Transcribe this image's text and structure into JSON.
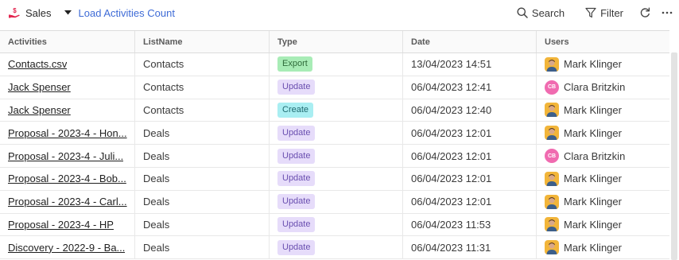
{
  "toolbar": {
    "app_icon": "money-hand-icon",
    "app_label": "Sales",
    "caret_icon": "caret-down-icon",
    "load_link": "Load Activities Count",
    "search_label": "Search",
    "filter_label": "Filter",
    "refresh_icon": "refresh-icon",
    "more_icon": "more-horizontal-icon"
  },
  "columns": [
    "Activities",
    "ListName",
    "Type",
    "Date",
    "Users"
  ],
  "badge_colors": {
    "Export": {
      "bg": "#a8ecb6",
      "fg": "#2f6b3a"
    },
    "Update": {
      "bg": "#e6dcfa",
      "fg": "#6a4fb0"
    },
    "Create": {
      "bg": "#a9eef2",
      "fg": "#1f6a70"
    }
  },
  "rows": [
    {
      "activity": "Contacts.csv",
      "list": "Contacts",
      "type": "Export",
      "date": "13/04/2023 14:51",
      "user": "Mark Klinger",
      "avatar": "photo"
    },
    {
      "activity": "Jack Spenser",
      "list": "Contacts",
      "type": "Update",
      "date": "06/04/2023 12:41",
      "user": "Clara Britzkin",
      "avatar": "CB"
    },
    {
      "activity": "Jack Spenser",
      "list": "Contacts",
      "type": "Create",
      "date": "06/04/2023 12:40",
      "user": "Mark Klinger",
      "avatar": "photo"
    },
    {
      "activity": "Proposal - 2023-4 - Hon...",
      "list": "Deals",
      "type": "Update",
      "date": "06/04/2023 12:01",
      "user": "Mark Klinger",
      "avatar": "photo"
    },
    {
      "activity": "Proposal - 2023-4 - Juli...",
      "list": "Deals",
      "type": "Update",
      "date": "06/04/2023 12:01",
      "user": "Clara Britzkin",
      "avatar": "CB"
    },
    {
      "activity": "Proposal - 2023-4 - Bob...",
      "list": "Deals",
      "type": "Update",
      "date": "06/04/2023 12:01",
      "user": "Mark Klinger",
      "avatar": "photo"
    },
    {
      "activity": "Proposal - 2023-4 - Carl...",
      "list": "Deals",
      "type": "Update",
      "date": "06/04/2023 12:01",
      "user": "Mark Klinger",
      "avatar": "photo"
    },
    {
      "activity": "Proposal - 2023-4 - HP",
      "list": "Deals",
      "type": "Update",
      "date": "06/04/2023 11:53",
      "user": "Mark Klinger",
      "avatar": "photo"
    },
    {
      "activity": "Discovery - 2022-9 - Ba...",
      "list": "Deals",
      "type": "Update",
      "date": "06/04/2023 11:31",
      "user": "Mark Klinger",
      "avatar": "photo"
    }
  ],
  "colors": {
    "link": "#3e6bd6",
    "avatar_photo_bg": "#f2b53a",
    "avatar_initials_bg": "#f06bb0"
  }
}
